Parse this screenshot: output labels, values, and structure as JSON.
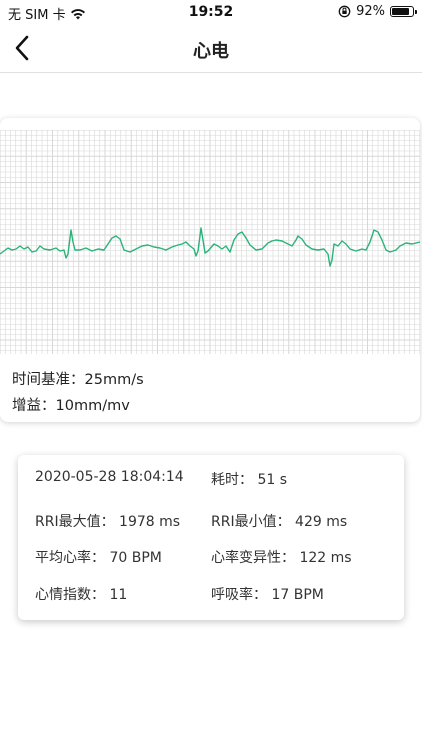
{
  "status_bar": {
    "carrier": "无 SIM 卡",
    "time": "19:52",
    "battery": "92%",
    "battery_level": 0.92
  },
  "nav": {
    "title": "心电",
    "back_icon": "chevron-left-icon"
  },
  "ecg": {
    "time_base": "时间基准：25mm/s",
    "gain": "增益：10mm/mv",
    "line_color": "#2bb37a",
    "grid_color": "#d7d7d7"
  },
  "stats": {
    "datetime": "2020-05-28 18:04:14",
    "duration": "耗时：  51 s",
    "rri_max": "RRI最大值：  1978 ms",
    "rri_min": "RRI最小值：  429 ms",
    "avg_hr": "平均心率：  70 BPM",
    "hrv": "心率变异性：  122 ms",
    "mood_index": "心情指数：  11",
    "respiration": "呼吸率：  17 BPM"
  }
}
